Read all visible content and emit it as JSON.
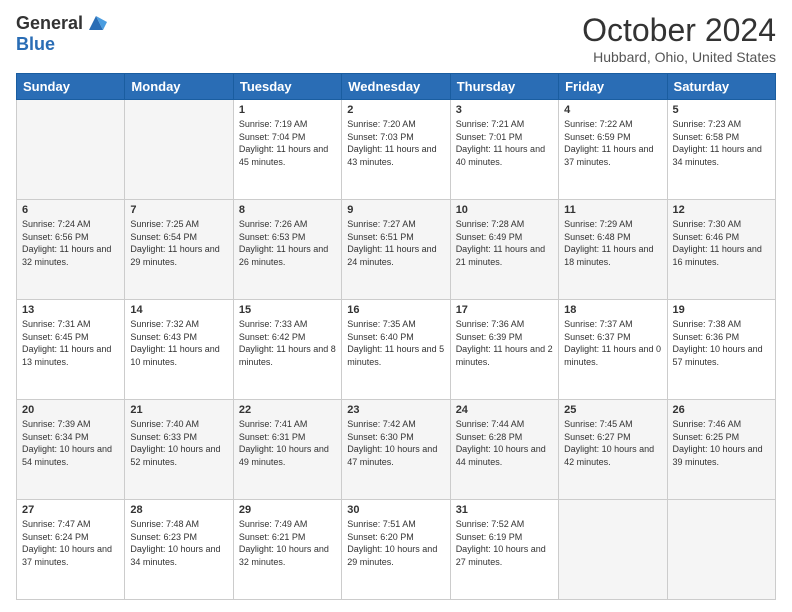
{
  "logo": {
    "general": "General",
    "blue": "Blue"
  },
  "header": {
    "month": "October 2024",
    "location": "Hubbard, Ohio, United States"
  },
  "weekdays": [
    "Sunday",
    "Monday",
    "Tuesday",
    "Wednesday",
    "Thursday",
    "Friday",
    "Saturday"
  ],
  "days": [
    {
      "date": "",
      "sunrise": "",
      "sunset": "",
      "daylight": ""
    },
    {
      "date": "",
      "sunrise": "",
      "sunset": "",
      "daylight": ""
    },
    {
      "date": "1",
      "sunrise": "Sunrise: 7:19 AM",
      "sunset": "Sunset: 7:04 PM",
      "daylight": "Daylight: 11 hours and 45 minutes."
    },
    {
      "date": "2",
      "sunrise": "Sunrise: 7:20 AM",
      "sunset": "Sunset: 7:03 PM",
      "daylight": "Daylight: 11 hours and 43 minutes."
    },
    {
      "date": "3",
      "sunrise": "Sunrise: 7:21 AM",
      "sunset": "Sunset: 7:01 PM",
      "daylight": "Daylight: 11 hours and 40 minutes."
    },
    {
      "date": "4",
      "sunrise": "Sunrise: 7:22 AM",
      "sunset": "Sunset: 6:59 PM",
      "daylight": "Daylight: 11 hours and 37 minutes."
    },
    {
      "date": "5",
      "sunrise": "Sunrise: 7:23 AM",
      "sunset": "Sunset: 6:58 PM",
      "daylight": "Daylight: 11 hours and 34 minutes."
    },
    {
      "date": "6",
      "sunrise": "Sunrise: 7:24 AM",
      "sunset": "Sunset: 6:56 PM",
      "daylight": "Daylight: 11 hours and 32 minutes."
    },
    {
      "date": "7",
      "sunrise": "Sunrise: 7:25 AM",
      "sunset": "Sunset: 6:54 PM",
      "daylight": "Daylight: 11 hours and 29 minutes."
    },
    {
      "date": "8",
      "sunrise": "Sunrise: 7:26 AM",
      "sunset": "Sunset: 6:53 PM",
      "daylight": "Daylight: 11 hours and 26 minutes."
    },
    {
      "date": "9",
      "sunrise": "Sunrise: 7:27 AM",
      "sunset": "Sunset: 6:51 PM",
      "daylight": "Daylight: 11 hours and 24 minutes."
    },
    {
      "date": "10",
      "sunrise": "Sunrise: 7:28 AM",
      "sunset": "Sunset: 6:49 PM",
      "daylight": "Daylight: 11 hours and 21 minutes."
    },
    {
      "date": "11",
      "sunrise": "Sunrise: 7:29 AM",
      "sunset": "Sunset: 6:48 PM",
      "daylight": "Daylight: 11 hours and 18 minutes."
    },
    {
      "date": "12",
      "sunrise": "Sunrise: 7:30 AM",
      "sunset": "Sunset: 6:46 PM",
      "daylight": "Daylight: 11 hours and 16 minutes."
    },
    {
      "date": "13",
      "sunrise": "Sunrise: 7:31 AM",
      "sunset": "Sunset: 6:45 PM",
      "daylight": "Daylight: 11 hours and 13 minutes."
    },
    {
      "date": "14",
      "sunrise": "Sunrise: 7:32 AM",
      "sunset": "Sunset: 6:43 PM",
      "daylight": "Daylight: 11 hours and 10 minutes."
    },
    {
      "date": "15",
      "sunrise": "Sunrise: 7:33 AM",
      "sunset": "Sunset: 6:42 PM",
      "daylight": "Daylight: 11 hours and 8 minutes."
    },
    {
      "date": "16",
      "sunrise": "Sunrise: 7:35 AM",
      "sunset": "Sunset: 6:40 PM",
      "daylight": "Daylight: 11 hours and 5 minutes."
    },
    {
      "date": "17",
      "sunrise": "Sunrise: 7:36 AM",
      "sunset": "Sunset: 6:39 PM",
      "daylight": "Daylight: 11 hours and 2 minutes."
    },
    {
      "date": "18",
      "sunrise": "Sunrise: 7:37 AM",
      "sunset": "Sunset: 6:37 PM",
      "daylight": "Daylight: 11 hours and 0 minutes."
    },
    {
      "date": "19",
      "sunrise": "Sunrise: 7:38 AM",
      "sunset": "Sunset: 6:36 PM",
      "daylight": "Daylight: 10 hours and 57 minutes."
    },
    {
      "date": "20",
      "sunrise": "Sunrise: 7:39 AM",
      "sunset": "Sunset: 6:34 PM",
      "daylight": "Daylight: 10 hours and 54 minutes."
    },
    {
      "date": "21",
      "sunrise": "Sunrise: 7:40 AM",
      "sunset": "Sunset: 6:33 PM",
      "daylight": "Daylight: 10 hours and 52 minutes."
    },
    {
      "date": "22",
      "sunrise": "Sunrise: 7:41 AM",
      "sunset": "Sunset: 6:31 PM",
      "daylight": "Daylight: 10 hours and 49 minutes."
    },
    {
      "date": "23",
      "sunrise": "Sunrise: 7:42 AM",
      "sunset": "Sunset: 6:30 PM",
      "daylight": "Daylight: 10 hours and 47 minutes."
    },
    {
      "date": "24",
      "sunrise": "Sunrise: 7:44 AM",
      "sunset": "Sunset: 6:28 PM",
      "daylight": "Daylight: 10 hours and 44 minutes."
    },
    {
      "date": "25",
      "sunrise": "Sunrise: 7:45 AM",
      "sunset": "Sunset: 6:27 PM",
      "daylight": "Daylight: 10 hours and 42 minutes."
    },
    {
      "date": "26",
      "sunrise": "Sunrise: 7:46 AM",
      "sunset": "Sunset: 6:25 PM",
      "daylight": "Daylight: 10 hours and 39 minutes."
    },
    {
      "date": "27",
      "sunrise": "Sunrise: 7:47 AM",
      "sunset": "Sunset: 6:24 PM",
      "daylight": "Daylight: 10 hours and 37 minutes."
    },
    {
      "date": "28",
      "sunrise": "Sunrise: 7:48 AM",
      "sunset": "Sunset: 6:23 PM",
      "daylight": "Daylight: 10 hours and 34 minutes."
    },
    {
      "date": "29",
      "sunrise": "Sunrise: 7:49 AM",
      "sunset": "Sunset: 6:21 PM",
      "daylight": "Daylight: 10 hours and 32 minutes."
    },
    {
      "date": "30",
      "sunrise": "Sunrise: 7:51 AM",
      "sunset": "Sunset: 6:20 PM",
      "daylight": "Daylight: 10 hours and 29 minutes."
    },
    {
      "date": "31",
      "sunrise": "Sunrise: 7:52 AM",
      "sunset": "Sunset: 6:19 PM",
      "daylight": "Daylight: 10 hours and 27 minutes."
    },
    {
      "date": "",
      "sunrise": "",
      "sunset": "",
      "daylight": ""
    },
    {
      "date": "",
      "sunrise": "",
      "sunset": "",
      "daylight": ""
    }
  ]
}
